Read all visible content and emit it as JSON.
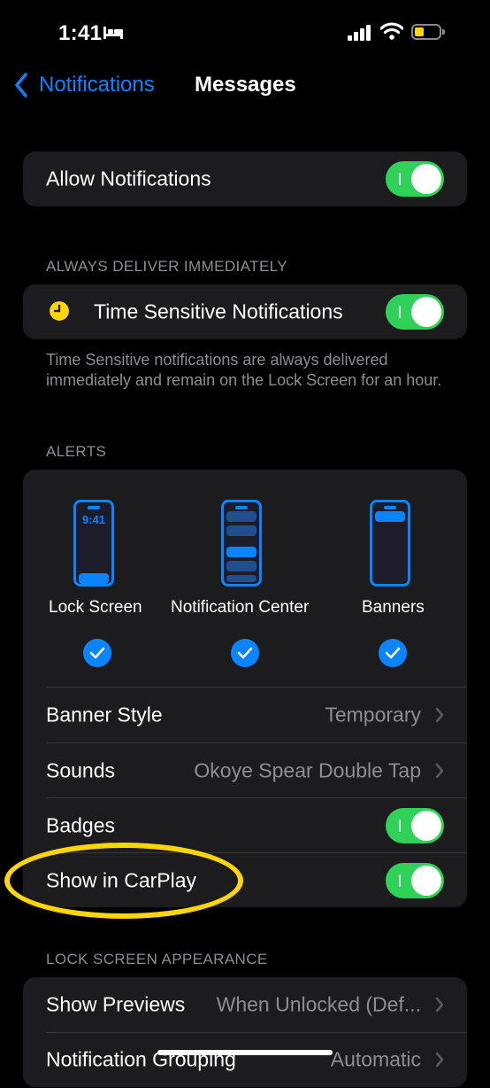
{
  "status_bar": {
    "time": "1:41"
  },
  "nav": {
    "back_label": "Notifications",
    "title": "Messages"
  },
  "allow_notifications": {
    "label": "Allow Notifications",
    "on": true
  },
  "time_sensitive": {
    "header": "ALWAYS DELIVER IMMEDIATELY",
    "label": "Time Sensitive Notifications",
    "on": true,
    "footer": "Time Sensitive notifications are always delivered immediately and remain on the Lock Screen for an hour."
  },
  "alerts": {
    "header": "ALERTS",
    "previews": [
      {
        "label": "Lock Screen",
        "clock": "9:41",
        "checked": true
      },
      {
        "label": "Notification Center",
        "checked": true
      },
      {
        "label": "Banners",
        "checked": true
      }
    ],
    "banner_style": {
      "label": "Banner Style",
      "value": "Temporary"
    },
    "sounds": {
      "label": "Sounds",
      "value": "Okoye Spear Double Tap"
    },
    "badges": {
      "label": "Badges",
      "on": true
    },
    "show_in_carplay": {
      "label": "Show in CarPlay",
      "on": true
    }
  },
  "lock_screen_appearance": {
    "header": "LOCK SCREEN APPEARANCE",
    "show_previews": {
      "label": "Show Previews",
      "value": "When Unlocked (Def..."
    },
    "notification_grouping": {
      "label": "Notification Grouping",
      "value": "Automatic"
    }
  },
  "colors": {
    "accent": "#0a84ff",
    "toggle_on": "#30d158",
    "annotation": "#ffd60a",
    "background": "#000000",
    "cell": "#1c1c1e"
  }
}
